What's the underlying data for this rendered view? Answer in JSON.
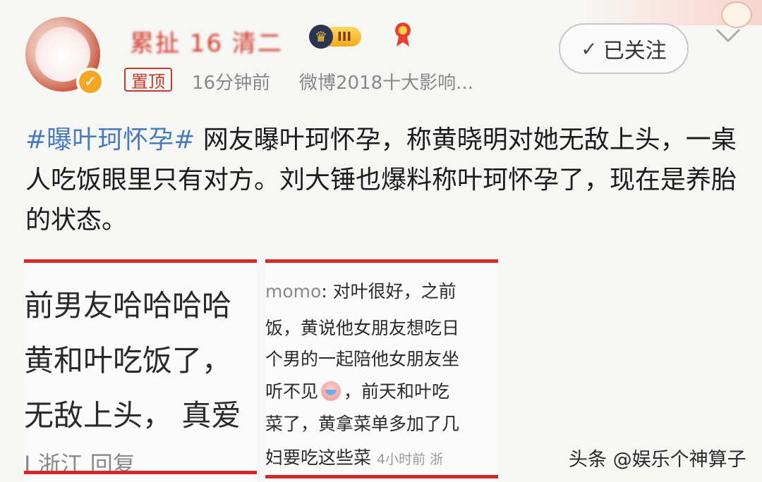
{
  "header": {
    "username": "累扯 16 清二",
    "rank_level": "III",
    "pinned_label": "置顶",
    "time_ago": "16分钟前",
    "source": "微博2018十大影响...",
    "follow_label": "已关注"
  },
  "post": {
    "hashtag": "#曝叶珂怀孕#",
    "body": " 网友曝叶珂怀孕，称黄晓明对她无敌上头，一桌人吃饭眼里只有对方。刘大锤也爆料称叶珂怀孕了，现在是养胎的状态。"
  },
  "screenshot_left": {
    "lines": [
      "前男友哈哈哈哈",
      "黄和叶吃饭了，",
      "无敌上头，  真爱"
    ],
    "meta": "I 浙江  回复"
  },
  "screenshot_right": {
    "username": "momo",
    "line1_text": ": 对叶很好，之前",
    "line2": "饭，黄说他女朋友想吃日",
    "line3": "个男的一起陪他女朋友坐",
    "line4_before": "听不见",
    "line4_after": "，前天和叶吃",
    "line5": "菜了，黄拿菜单多加了几",
    "line6_text": "妇要吃这些菜",
    "line6_time": "4小时前  浙"
  },
  "watermark": "头条 @娱乐个神算子",
  "colors": {
    "hashtag": "#4a7bbd",
    "accent_red": "#d9262a",
    "meta_gray": "#888888"
  }
}
